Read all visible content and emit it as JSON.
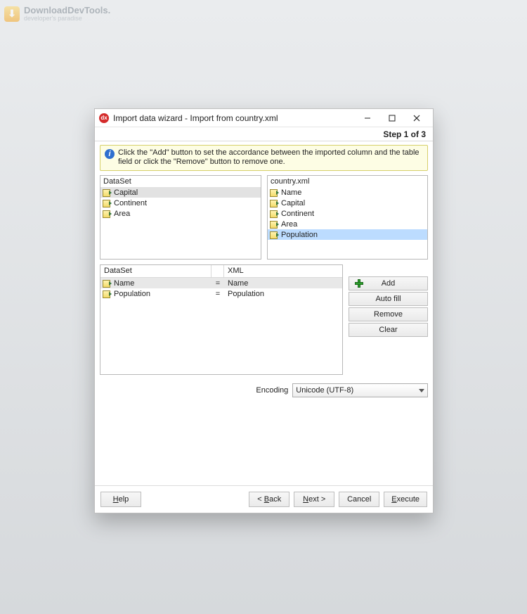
{
  "watermark": {
    "brand": "DownloadDevTools.",
    "tagline": "developer's paradise"
  },
  "title": "Import data wizard - Import from country.xml",
  "step_label": "Step 1 of 3",
  "info_message": "Click the \"Add\" button to set the accordance between the imported column and the table field or click the \"Remove\" button to remove one.",
  "dataset": {
    "header": "DataSet",
    "items": [
      "Capital",
      "Continent",
      "Area"
    ],
    "selected_index": 0
  },
  "source": {
    "header": "country.xml",
    "items": [
      "Name",
      "Capital",
      "Continent",
      "Area",
      "Population"
    ],
    "selected_index": 4
  },
  "mapping": {
    "headers": {
      "dataset": "DataSet",
      "xml": "XML"
    },
    "rows": [
      {
        "dataset": "Name",
        "xml": "Name"
      },
      {
        "dataset": "Population",
        "xml": "Population"
      }
    ],
    "selected_index": 0
  },
  "buttons": {
    "add": "Add",
    "autofill": "Auto fill",
    "remove": "Remove",
    "clear": "Clear"
  },
  "encoding": {
    "label": "Encoding",
    "value": "Unicode (UTF-8)"
  },
  "footer": {
    "help": "Help",
    "back": "< Back",
    "next": "Next >",
    "cancel": "Cancel",
    "execute": "Execute"
  }
}
